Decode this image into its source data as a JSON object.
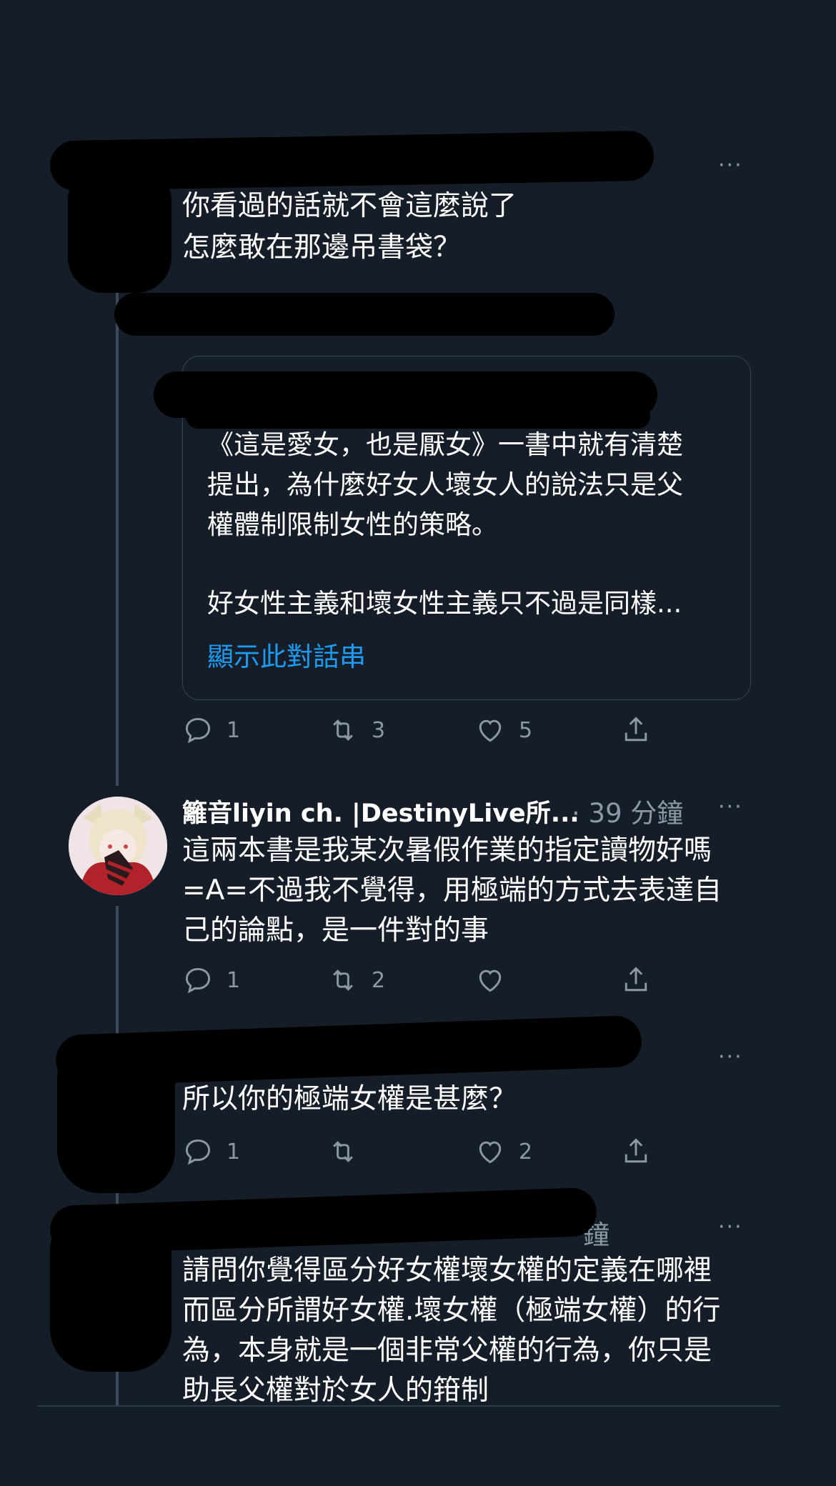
{
  "tweet1": {
    "menu": "···",
    "text_line1": "你看過的話就不會這麼說了",
    "text_line2": "怎麼敢在那邊吊書袋？"
  },
  "quote": {
    "line1": "《這是愛女，也是厭女》一書中就有清楚",
    "line2": "提出，為什麼好女人壞女人的說法只是父",
    "line3": "權體制限制女性的策略。",
    "line4": "好女性主義和壞女性主義只不過是同樣...",
    "show_thread": "顯示此對話串"
  },
  "tweet1_actions": {
    "replies": "1",
    "retweets": "3",
    "likes": "5"
  },
  "tweet2": {
    "name": "籬音liyin ch. |DestinyLive所...",
    "time": "· 39 分鐘",
    "menu": "···",
    "text_line1": "這兩本書是我某次暑假作業的指定讀物好嗎",
    "text_line2": "=A=不過我不覺得，用極端的方式去表達自",
    "text_line3": "己的論點，是一件對的事",
    "replies": "1",
    "retweets": "2"
  },
  "tweet3": {
    "menu": "···",
    "text_line1": "所以你的極端女權是甚麼？",
    "replies": "1",
    "likes": "2"
  },
  "tweet4": {
    "time_fragment": "鐘",
    "menu": "···",
    "text_line1": "請問你覺得區分好女權壞女權的定義在哪裡",
    "text_line2": "而區分所謂好女權.壞女權（極端女權）的行",
    "text_line3": "為，本身就是一個非常父權的行為，你只是",
    "text_line4": "助長父權對於女人的箝制"
  },
  "colors": {
    "background": "#151d28",
    "text": "#ffffff",
    "muted": "#8b98a5",
    "link": "#1d9bf0",
    "border": "#38444d"
  }
}
